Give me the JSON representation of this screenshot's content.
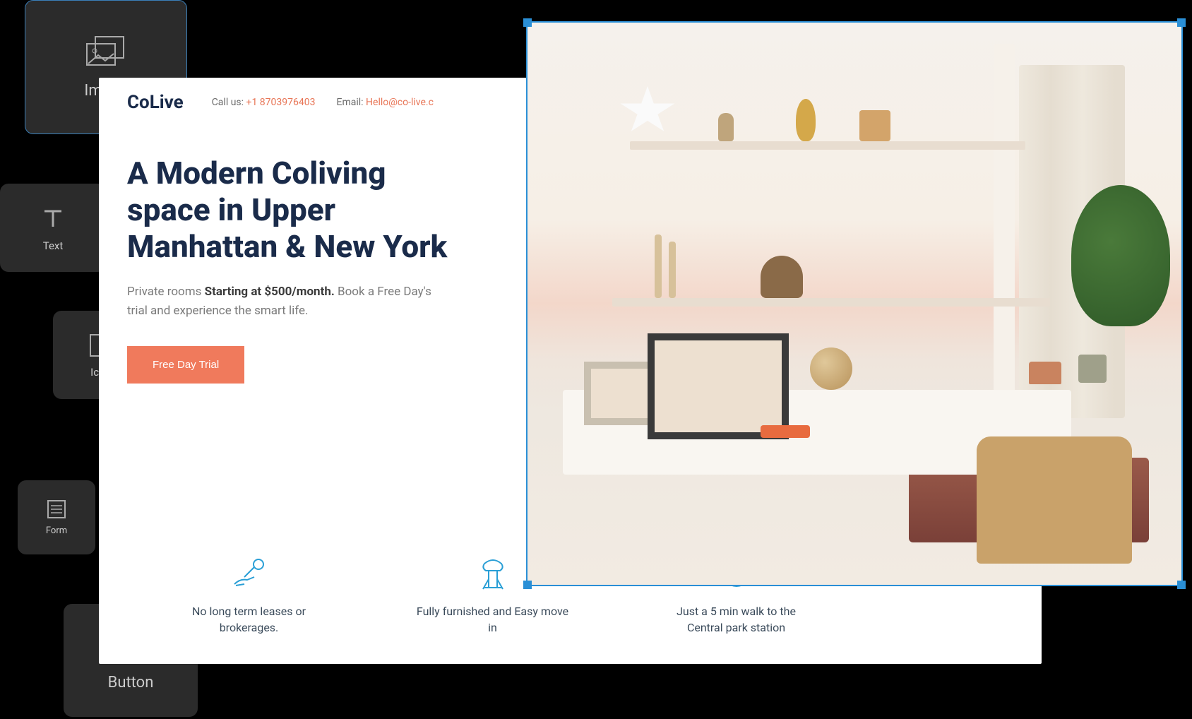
{
  "widgets": {
    "image": "Image",
    "text": "Text",
    "icon": "Icon",
    "form": "Form",
    "button": "Button"
  },
  "site": {
    "logo": "CoLive",
    "header": {
      "call_label": "Call us:",
      "call_value": "+1 8703976403",
      "email_label": "Email:",
      "email_value": "Hello@co-live.c"
    },
    "hero": {
      "title": "A Modern Coliving space in Upper Manhattan & New York",
      "sub_prefix": "Private rooms ",
      "sub_strong": "Starting at $500/month.",
      "sub_suffix": " Book a Free Day's trial and experience the smart life.",
      "cta": "Free Day Trial"
    },
    "features": [
      {
        "text": "No long term leases or brokerages."
      },
      {
        "text": "Fully furnished and Easy move in"
      },
      {
        "text": "Just a 5 min walk to the Central park station"
      }
    ]
  }
}
